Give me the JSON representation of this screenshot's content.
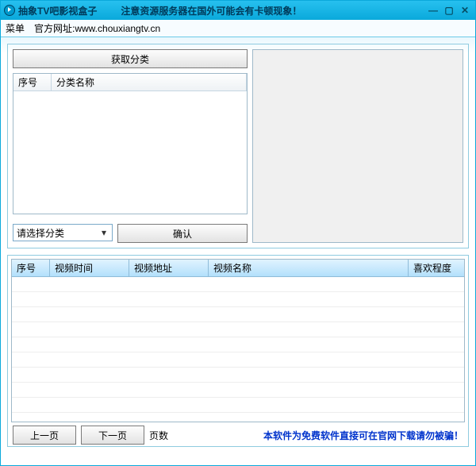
{
  "titlebar": {
    "app_title": "抽象TV吧影视盒子",
    "notice": "注意资源服务器在国外可能会有卡顿现象！"
  },
  "menubar": {
    "menu": "菜单",
    "site_label": "官方网址:www.chouxiangtv.cn"
  },
  "left_panel": {
    "get_category_btn": "获取分类",
    "col_index": "序号",
    "col_name": "分类名称",
    "select_placeholder": "请选择分类",
    "confirm_btn": "确认"
  },
  "bottom_list": {
    "col_index": "序号",
    "col_time": "视频时间",
    "col_url": "视频地址",
    "col_name": "视频名称",
    "col_rating": "喜欢程度"
  },
  "footer": {
    "prev": "上一页",
    "next": "下一页",
    "pages_label": "页数",
    "note": "本软件为免费软件直接可在官网下载请勿被骗！"
  }
}
